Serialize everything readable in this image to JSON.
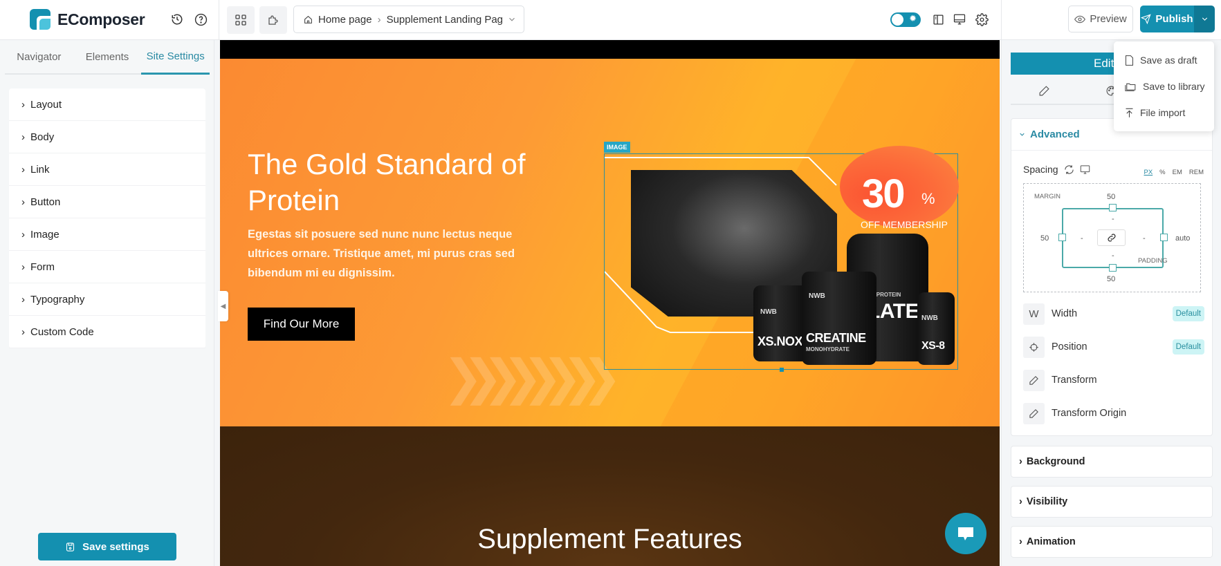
{
  "app": {
    "name": "EComposer",
    "brand_color": "#1490b0"
  },
  "topbar": {
    "history_icon": "history-icon",
    "help_icon": "help-icon",
    "grid_icon": "grid-icon",
    "puzzle_icon": "puzzle-icon",
    "breadcrumb": {
      "home": "Home page",
      "current": "Supplement Landing Pag"
    },
    "theme_toggle": "on",
    "preview_label": "Preview",
    "publish_label": "Publish"
  },
  "publish_menu": {
    "items": [
      {
        "label": "Save as draft",
        "icon": "file-icon"
      },
      {
        "label": "Save to library",
        "icon": "folder-icon"
      },
      {
        "label": "File import",
        "icon": "upload-icon"
      }
    ]
  },
  "sidebar": {
    "tabs": [
      {
        "label": "Navigator"
      },
      {
        "label": "Elements"
      },
      {
        "label": "Site Settings",
        "active": true
      }
    ],
    "items": [
      {
        "label": "Layout"
      },
      {
        "label": "Body"
      },
      {
        "label": "Link"
      },
      {
        "label": "Button"
      },
      {
        "label": "Image"
      },
      {
        "label": "Form"
      },
      {
        "label": "Typography"
      },
      {
        "label": "Custom Code"
      }
    ],
    "save_label": "Save settings"
  },
  "canvas": {
    "hero": {
      "title": "The Gold Standard of Protein",
      "description": "Egestas sit posuere sed nunc nunc lectus neque ultrices ornare. Tristique amet, mi purus cras sed bibendum mi eu dignissim.",
      "button_label": "Find Our More",
      "image_tag": "IMAGE",
      "badge_number": "30",
      "badge_percent": "%",
      "badge_sub": "OFF MEMBERSHIP",
      "products": [
        {
          "brand": "NWB",
          "label": "XS.NOX",
          "sub": ""
        },
        {
          "brand": "NWB",
          "label": "CREATINE",
          "sub": "MONOHYDRATE"
        },
        {
          "brand": "NWB",
          "label": "LATE",
          "sub": "EY PROTEIN"
        },
        {
          "brand": "NWB",
          "label": "XS-8",
          "sub": ""
        }
      ]
    },
    "features_title": "Supplement Features"
  },
  "right_panel": {
    "editing_label": "Editing",
    "advanced_label": "Advanced",
    "spacing": {
      "label": "Spacing",
      "units": [
        "PX",
        "%",
        "EM",
        "REM"
      ],
      "active_unit": "PX",
      "margin_label": "MARGIN",
      "padding_label": "PADDING",
      "margin_top": "50",
      "margin_bottom": "50",
      "margin_left": "50",
      "margin_right": "auto",
      "padding_top": "-",
      "padding_bottom": "-",
      "padding_left": "-",
      "padding_right": "-"
    },
    "props": [
      {
        "label": "Width",
        "badge": "Default",
        "icon": "W"
      },
      {
        "label": "Position",
        "badge": "Default",
        "icon": "crosshair"
      },
      {
        "label": "Transform",
        "badge": "",
        "icon": "pencil"
      },
      {
        "label": "Transform Origin",
        "badge": "",
        "icon": "pencil"
      }
    ],
    "collapsed_sections": [
      {
        "label": "Background"
      },
      {
        "label": "Visibility"
      },
      {
        "label": "Animation"
      }
    ]
  }
}
